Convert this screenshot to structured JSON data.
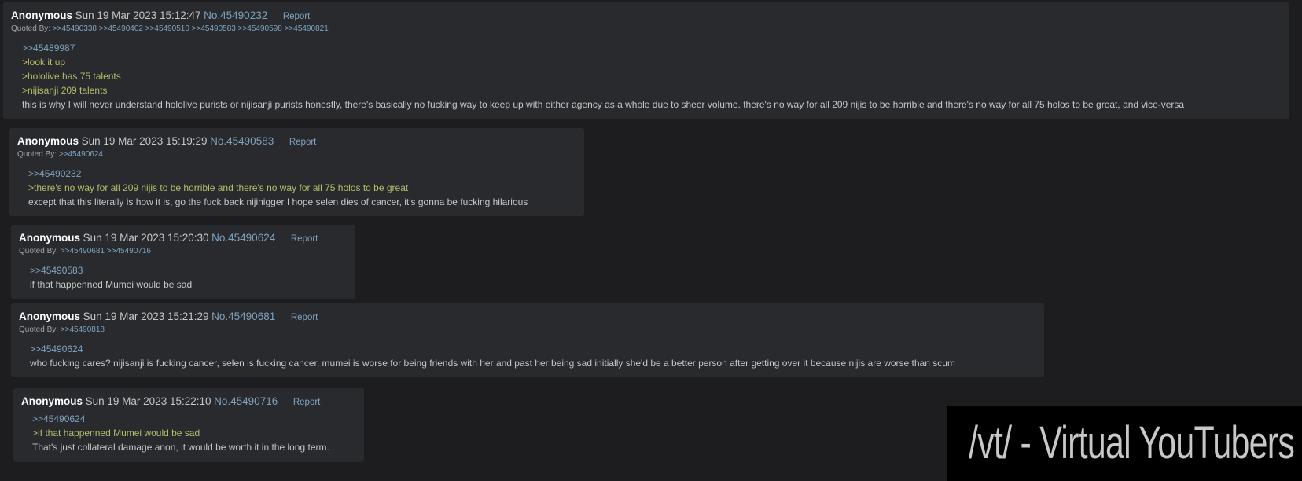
{
  "posts": [
    {
      "name": "Anonymous",
      "date": "Sun 19 Mar 2023 15:12:47",
      "number": "No.45490232",
      "report": "Report",
      "quoted_by_label": "Quoted By:",
      "quoted_by": [
        ">>45490338",
        ">>45490402",
        ">>45490510",
        ">>45490583",
        ">>45490598",
        ">>45490821"
      ],
      "body": [
        {
          "type": "quotelink",
          "text": ">>45489987"
        },
        {
          "type": "greentext",
          "text": ">look it up"
        },
        {
          "type": "greentext",
          "text": ">hololive has 75 talents"
        },
        {
          "type": "greentext",
          "text": ">nijisanji 209 talents"
        },
        {
          "type": "text",
          "text": "this is why I will never understand hololive purists or nijisanji purists honestly, there's basically no fucking way to keep up with either agency as a whole due to sheer volume. there's no way for all 209 nijis to be horrible and there's no way for all 75 holos to be great, and vice-versa"
        }
      ]
    },
    {
      "name": "Anonymous",
      "date": "Sun 19 Mar 2023 15:19:29",
      "number": "No.45490583",
      "report": "Report",
      "quoted_by_label": "Quoted By:",
      "quoted_by": [
        ">>45490624"
      ],
      "body": [
        {
          "type": "quotelink",
          "text": ">>45490232"
        },
        {
          "type": "greentext",
          "text": ">there's no way for all 209 nijis to be horrible and there's no way for all 75 holos to be great"
        },
        {
          "type": "text",
          "text": "except that this literally is how it is, go the fuck back nijinigger I hope selen dies of cancer, it's gonna be fucking hilarious"
        }
      ]
    },
    {
      "name": "Anonymous",
      "date": "Sun 19 Mar 2023 15:20:30",
      "number": "No.45490624",
      "report": "Report",
      "quoted_by_label": "Quoted By:",
      "quoted_by": [
        ">>45490681",
        ">>45490716"
      ],
      "body": [
        {
          "type": "quotelink",
          "text": ">>45490583"
        },
        {
          "type": "text",
          "text": "if that happenned Mumei would be sad"
        }
      ]
    },
    {
      "name": "Anonymous",
      "date": "Sun 19 Mar 2023 15:21:29",
      "number": "No.45490681",
      "report": "Report",
      "quoted_by_label": "Quoted By:",
      "quoted_by": [
        ">>45490818"
      ],
      "body": [
        {
          "type": "quotelink",
          "text": ">>45490624"
        },
        {
          "type": "text",
          "text": "who fucking cares? nijisanji is fucking cancer, selen is fucking cancer, mumei is worse for being friends with her and past her being sad initially she'd be a better person after getting over it because nijis are worse than scum"
        }
      ]
    },
    {
      "name": "Anonymous",
      "date": "Sun 19 Mar 2023 15:22:10",
      "number": "No.45490716",
      "report": "Report",
      "body": [
        {
          "type": "quotelink",
          "text": ">>45490624"
        },
        {
          "type": "greentext",
          "text": ">if that happenned Mumei would be sad"
        },
        {
          "type": "text",
          "text": "That's just collateral damage anon, it would be worth it in the long term."
        }
      ]
    }
  ],
  "banner": {
    "text": "/vt/ - Virtual YouTubers"
  },
  "colors": {
    "background": "#1d1d1f",
    "post_background": "#282a2e",
    "link": "#81a2be",
    "greentext": "#b5bd68",
    "text": "#c5c8c6",
    "name": "#ffffff"
  }
}
